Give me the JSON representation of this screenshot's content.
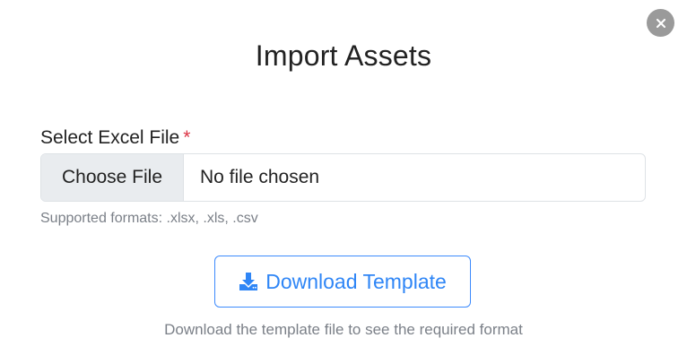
{
  "modal": {
    "title": "Import Assets",
    "close_icon": "close-icon"
  },
  "file_field": {
    "label": "Select Excel File",
    "required_marker": "*",
    "button_label": "Choose File",
    "value": "No file chosen",
    "help": "Supported formats: .xlsx, .xls, .csv"
  },
  "download": {
    "icon": "download-icon",
    "label": "Download Template",
    "note": "Download the template file to see the required format"
  },
  "colors": {
    "accent": "#2f86f6",
    "required": "#dc3545",
    "muted_text": "#7b8088",
    "close_button": "#9a9a9a"
  }
}
